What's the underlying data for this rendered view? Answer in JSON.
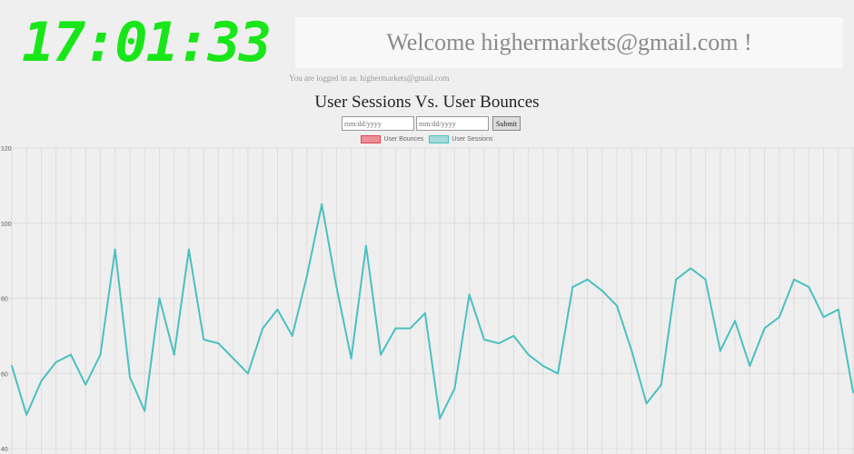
{
  "clock": {
    "time": "17:01:33"
  },
  "welcome": {
    "text": "Welcome highermarkets@gmail.com !"
  },
  "login_status": {
    "text": "You are logged in as: highermarkets@gmail.com"
  },
  "form": {
    "start_placeholder": "mm/dd/yyyy",
    "end_placeholder": "mm/dd/yyyy",
    "submit_label": "Submit"
  },
  "colors": {
    "bounces": "#e8414f",
    "sessions": "#4bc0c0",
    "grid": "#dddddd",
    "clock": "#19e619"
  },
  "chart_data": {
    "type": "line",
    "title": "User Sessions Vs. User Bounces",
    "legend": [
      "User Bounces",
      "User Sessions"
    ],
    "ylim": [
      40,
      120
    ],
    "yticks": [
      40,
      60,
      80,
      100,
      120
    ],
    "grid": true,
    "legend_position": "top",
    "series": [
      {
        "name": "User Bounces",
        "values": []
      },
      {
        "name": "User Sessions",
        "values": [
          62,
          49,
          58,
          63,
          65,
          57,
          65,
          93,
          59,
          50,
          80,
          65,
          93,
          69,
          68,
          64,
          60,
          72,
          77,
          70,
          86,
          105,
          83,
          64,
          94,
          65,
          72,
          72,
          76,
          48,
          56,
          81,
          69,
          68,
          70,
          65,
          62,
          60,
          83,
          85,
          82,
          78,
          66,
          52,
          57,
          85,
          88,
          85,
          66,
          74,
          62,
          72,
          75,
          85,
          83,
          75,
          77,
          55
        ]
      }
    ]
  }
}
